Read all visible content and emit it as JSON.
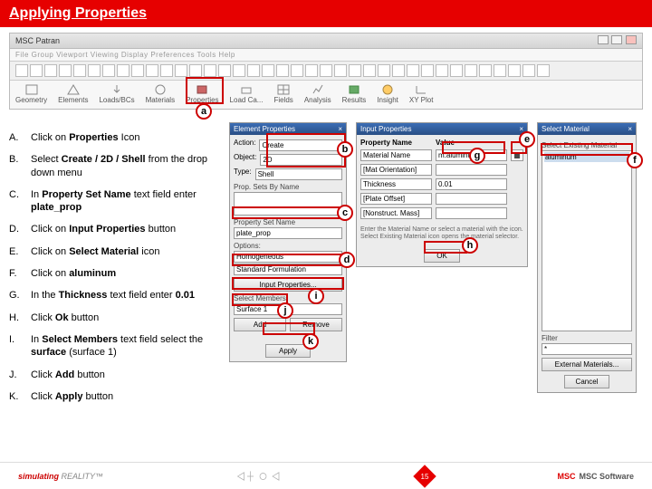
{
  "slide": {
    "title": "Applying Properties",
    "page_number": "15"
  },
  "patran_app": {
    "window_title": "MSC Patran",
    "menu_text": "File  Group  Viewport  Viewing  Display  Preferences  Tools  Help",
    "tabs": [
      "Geometry",
      "Elements",
      "Loads/BCs",
      "Materials",
      "Properties",
      "Load Ca...",
      "Fields",
      "Analysis",
      "Results",
      "Insight",
      "XY Plot"
    ]
  },
  "steps": [
    {
      "letter": "A.",
      "text_pre": "Click on ",
      "bold": "Properties",
      "text_post": " Icon"
    },
    {
      "letter": "B.",
      "text_pre": "Select ",
      "bold": "Create / 2D / Shell",
      "text_post": " from the drop down menu"
    },
    {
      "letter": "C.",
      "text_pre": "In ",
      "bold": "Property Set Name",
      "text_post": " text field enter ",
      "bold2": "plate_prop"
    },
    {
      "letter": "D.",
      "text_pre": "Click on ",
      "bold": "Input Properties",
      "text_post": " button"
    },
    {
      "letter": "E.",
      "text_pre": "Click on ",
      "bold": "Select Material",
      "text_post": " icon"
    },
    {
      "letter": "F.",
      "text_pre": "Click on ",
      "bold": "aluminum",
      "text_post": ""
    },
    {
      "letter": "G.",
      "text_pre": "In the ",
      "bold": "Thickness",
      "text_post": " text field enter ",
      "bold2": "0.01"
    },
    {
      "letter": "H.",
      "text_pre": "Click ",
      "bold": "Ok",
      "text_post": " button"
    },
    {
      "letter": "I.",
      "text_pre": "In ",
      "bold": "Select Members",
      "text_post": " text field select the ",
      "bold2": "surface",
      "text_post2": " (surface 1)"
    },
    {
      "letter": "J.",
      "text_pre": "Click ",
      "bold": "Add",
      "text_post": " button"
    },
    {
      "letter": "K.",
      "text_pre": "Click ",
      "bold": "Apply",
      "text_post": " button"
    }
  ],
  "elem_props": {
    "title": "Element Properties",
    "action_label": "Action:",
    "action_value": "Create",
    "obj_label": "Object:",
    "obj_value": "2D",
    "type_label": "Type:",
    "type_value": "Shell",
    "sets_label": "Prop. Sets By Name",
    "psn_label": "Property Set Name",
    "psn_value": "plate_prop",
    "options_label": "Options:",
    "opt1": "Homogeneous",
    "opt2": "Standard Formulation",
    "input_btn": "Input Properties...",
    "select_label": "Select Members",
    "select_value": "Surface 1",
    "add_btn": "Add",
    "remove_btn": "Remove",
    "apply_btn": "Apply"
  },
  "input_props": {
    "title": "Input Properties",
    "header1": "Property Name",
    "header2": "Value",
    "row_mat": "Material Name",
    "row_mat_val": "m:aluminum",
    "row_ori": "[Mat Orientation]",
    "row_th": "Thickness",
    "row_th_val": "0.01",
    "row_off": "[Plate Offset]",
    "row_nsm": "[Nonstruct. Mass]",
    "note": "Enter the Material Name or select a material with the icon. Select Existing Material icon opens the material selector.",
    "ok_btn": "OK"
  },
  "sel_material": {
    "title": "Select Material",
    "existing_label": "Select Existing Material",
    "material": "aluminum",
    "filter_label": "Filter",
    "filter_value": "*",
    "ext_btn": "External Materials...",
    "cancel_btn": "Cancel"
  },
  "footer": {
    "brand_left": "simulating",
    "brand_right": "REALITY™",
    "company": "MSC Software"
  }
}
